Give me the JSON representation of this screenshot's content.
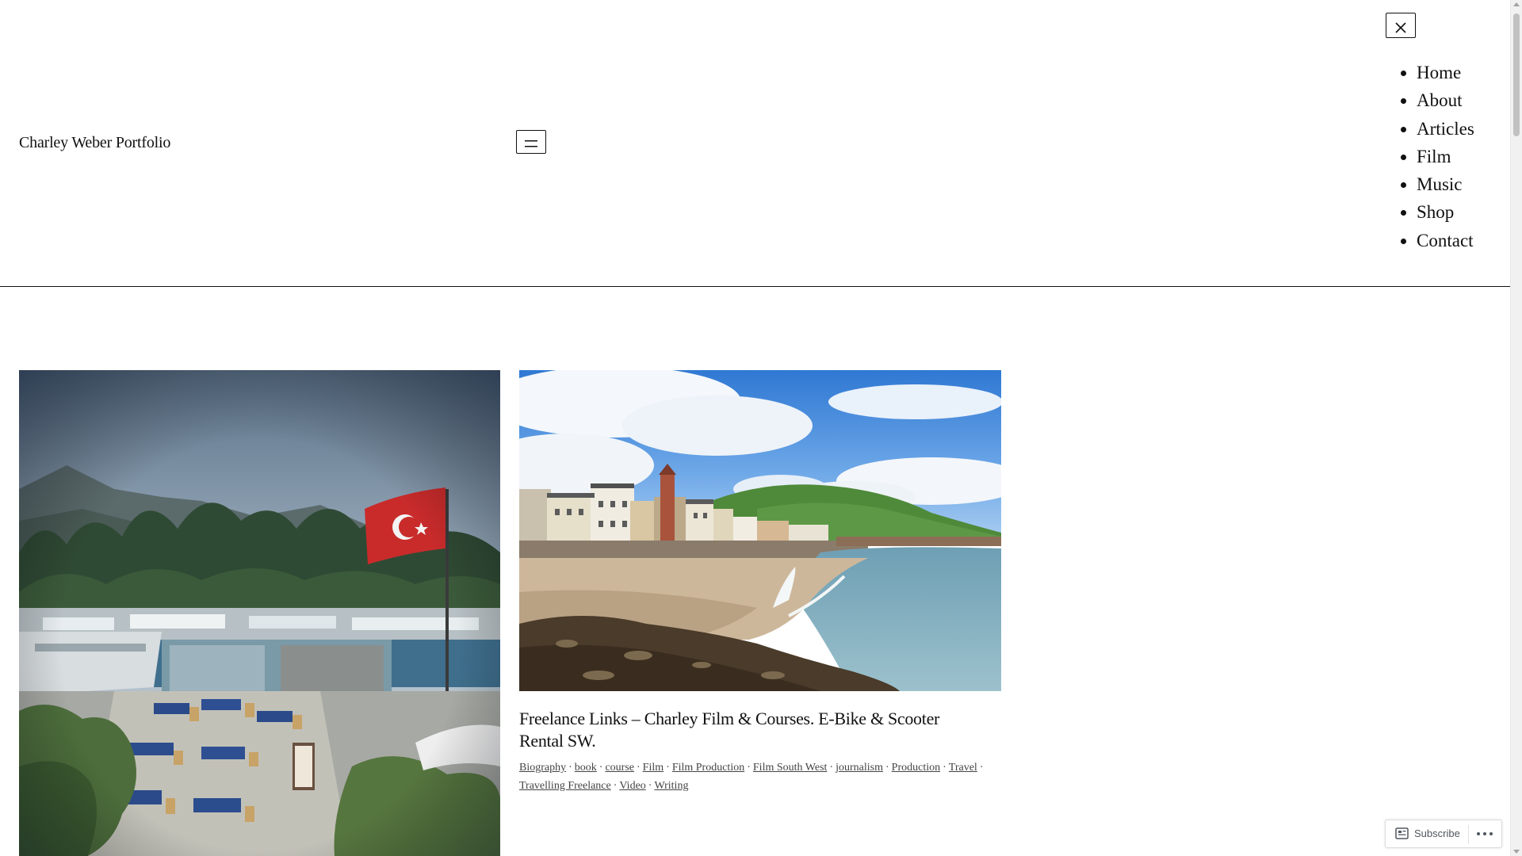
{
  "site": {
    "title": "Charley Weber Portfolio"
  },
  "header": {
    "menu_open_icon": "hamburger-menu-icon",
    "menu_close_icon": "close-icon"
  },
  "nav": {
    "items": [
      {
        "label": "Home"
      },
      {
        "label": "About"
      },
      {
        "label": "Articles"
      },
      {
        "label": "Film"
      },
      {
        "label": "Music"
      },
      {
        "label": "Shop"
      },
      {
        "label": "Contact"
      }
    ]
  },
  "posts": [
    {
      "image": "turkey-harbor-flag-photo",
      "title": "",
      "categories": []
    },
    {
      "image": "coastal-village-beach-photo",
      "title": "Freelance Links – Charley Film & Courses. E-Bike & Scooter Rental SW.",
      "categories": [
        "Biography",
        "book",
        "course",
        "Film",
        "Film Production",
        "Film South West",
        "journalism",
        "Production",
        "Travel",
        "Travelling Freelance",
        "Video",
        "Writing"
      ]
    }
  ],
  "subscribe": {
    "label": "Subscribe",
    "icon": "reader-icon",
    "more_icon": "ellipsis-icon"
  },
  "colors": {
    "text": "#111111",
    "background": "#ffffff",
    "meta_text": "#444444"
  }
}
